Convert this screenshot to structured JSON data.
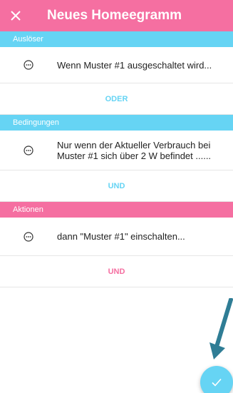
{
  "header": {
    "title": "Neues Homeegramm",
    "close_icon": "close-icon",
    "color": "#f56fa1"
  },
  "sections": {
    "triggers": {
      "label": "Auslöser",
      "color": "#66d4f4",
      "item_text": "Wenn Muster #1 ausgeschaltet wird...",
      "connector": "ODER"
    },
    "conditions": {
      "label": "Bedingungen",
      "color": "#66d4f4",
      "item_line1": "Nur wenn der Aktueller Verbrauch bei",
      "item_line2": "Muster #1 sich über 2 W befindet ......",
      "connector": "UND"
    },
    "actions": {
      "label": "Aktionen",
      "color": "#f56fa1",
      "item_text": "dann \"Muster #1\" einschalten...",
      "connector": "UND"
    }
  },
  "item_icon": "more-dots-icon",
  "fab": {
    "icon": "check-icon",
    "color": "#66d4f4"
  },
  "annotation_arrow_color": "#2f7d95"
}
